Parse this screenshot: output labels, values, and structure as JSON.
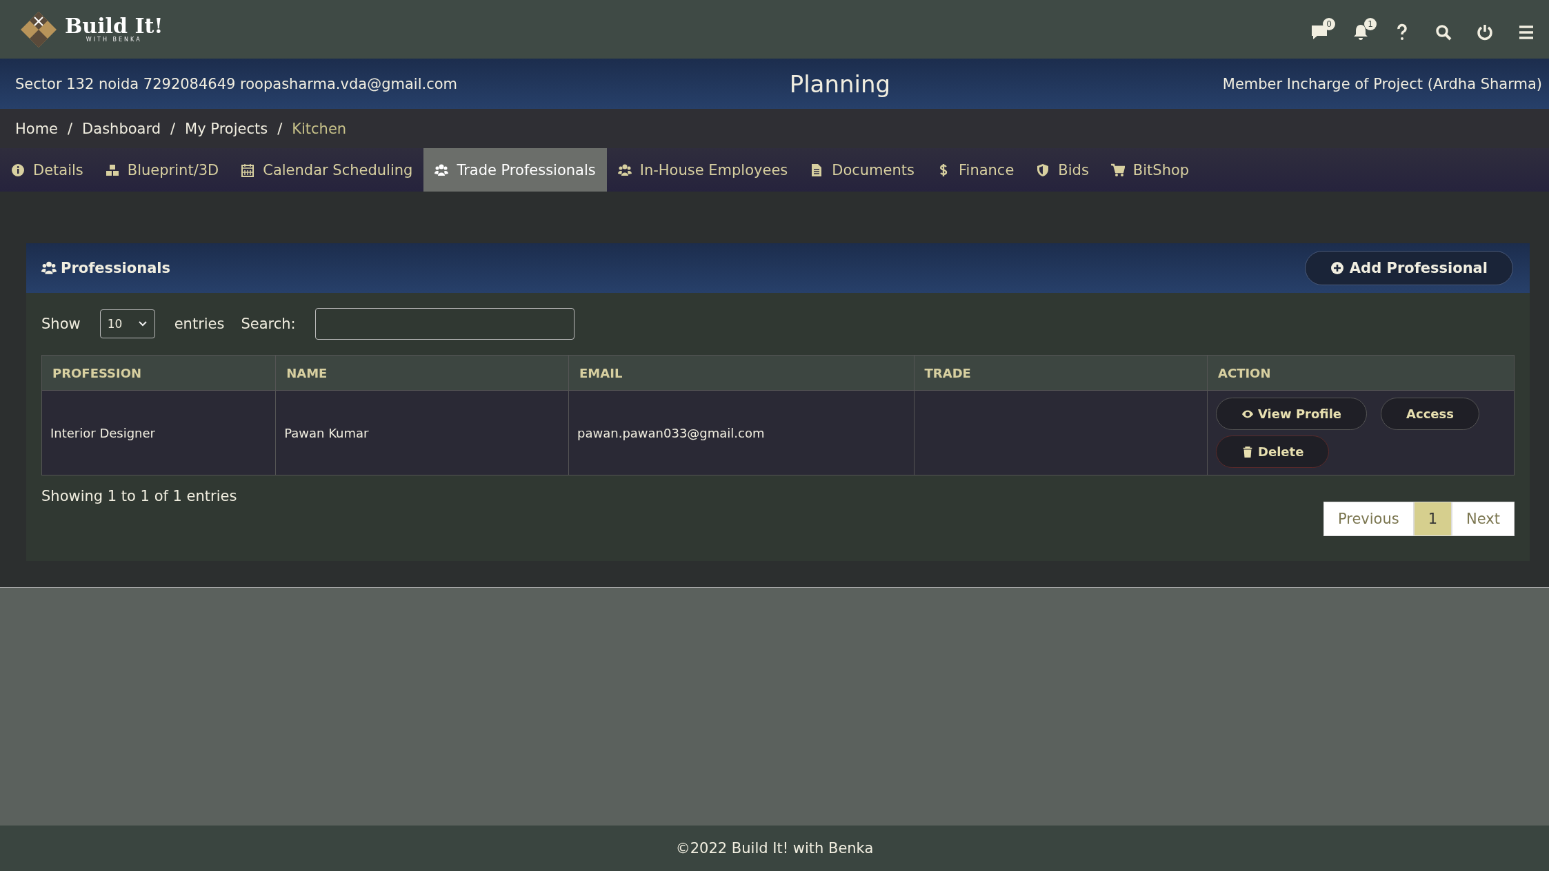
{
  "header": {
    "logo_title": "Build It!",
    "logo_subtitle": "WITH BENKA",
    "icons": [
      {
        "kind": "chat",
        "badge": "0"
      },
      {
        "kind": "bell",
        "badge": "1"
      },
      {
        "kind": "help"
      },
      {
        "kind": "search"
      },
      {
        "kind": "power"
      },
      {
        "kind": "menu"
      }
    ]
  },
  "info_bar": {
    "contact": "Sector 132 noida 7292084649 roopasharma.vda@gmail.com",
    "title": "Planning",
    "member": "Member Incharge of Project (Ardha Sharma)"
  },
  "breadcrumb": [
    {
      "label": "Home",
      "current": false
    },
    {
      "label": "Dashboard",
      "current": false
    },
    {
      "label": "My Projects",
      "current": false
    },
    {
      "label": "Kitchen",
      "current": true
    }
  ],
  "breadcrumb_separator": "/",
  "tabs": [
    {
      "kind": "info",
      "label": "Details",
      "selected": false
    },
    {
      "kind": "cubes",
      "label": "Blueprint/3D",
      "selected": false
    },
    {
      "kind": "calendar",
      "label": "Calendar Scheduling",
      "selected": false
    },
    {
      "kind": "users",
      "label": "Trade Professionals",
      "selected": true
    },
    {
      "kind": "users",
      "label": "In-House Employees",
      "selected": false
    },
    {
      "kind": "file",
      "label": "Documents",
      "selected": false
    },
    {
      "kind": "dollar",
      "label": "Finance",
      "selected": false
    },
    {
      "kind": "shield",
      "label": "Bids",
      "selected": false
    },
    {
      "kind": "cart",
      "label": "BitShop",
      "selected": false
    }
  ],
  "card": {
    "title": "Professionals",
    "add_button": "Add Professional",
    "show_label": "Show",
    "page_size": "10",
    "entries_label": "entries",
    "search_label": "Search:",
    "table": {
      "columns": [
        "PROFESSION",
        "NAME",
        "EMAIL",
        "TRADE",
        "ACTION"
      ],
      "rows": [
        {
          "profession": "Interior Designer",
          "name": "Pawan Kumar",
          "email": "pawan.pawan033@gmail.com",
          "actions": [
            {
              "kind": "view",
              "label": "View Profile"
            },
            {
              "kind": "access",
              "label": "Access"
            },
            {
              "kind": "delete",
              "label": "Delete"
            }
          ]
        }
      ]
    },
    "summary": "Showing 1 to 1 of 1 entries",
    "pagination": [
      {
        "label": "Previous",
        "selected": false
      },
      {
        "label": "1",
        "selected": true
      },
      {
        "label": "Next",
        "selected": false
      }
    ]
  },
  "footer": "©2022 Build It! with Benka"
}
